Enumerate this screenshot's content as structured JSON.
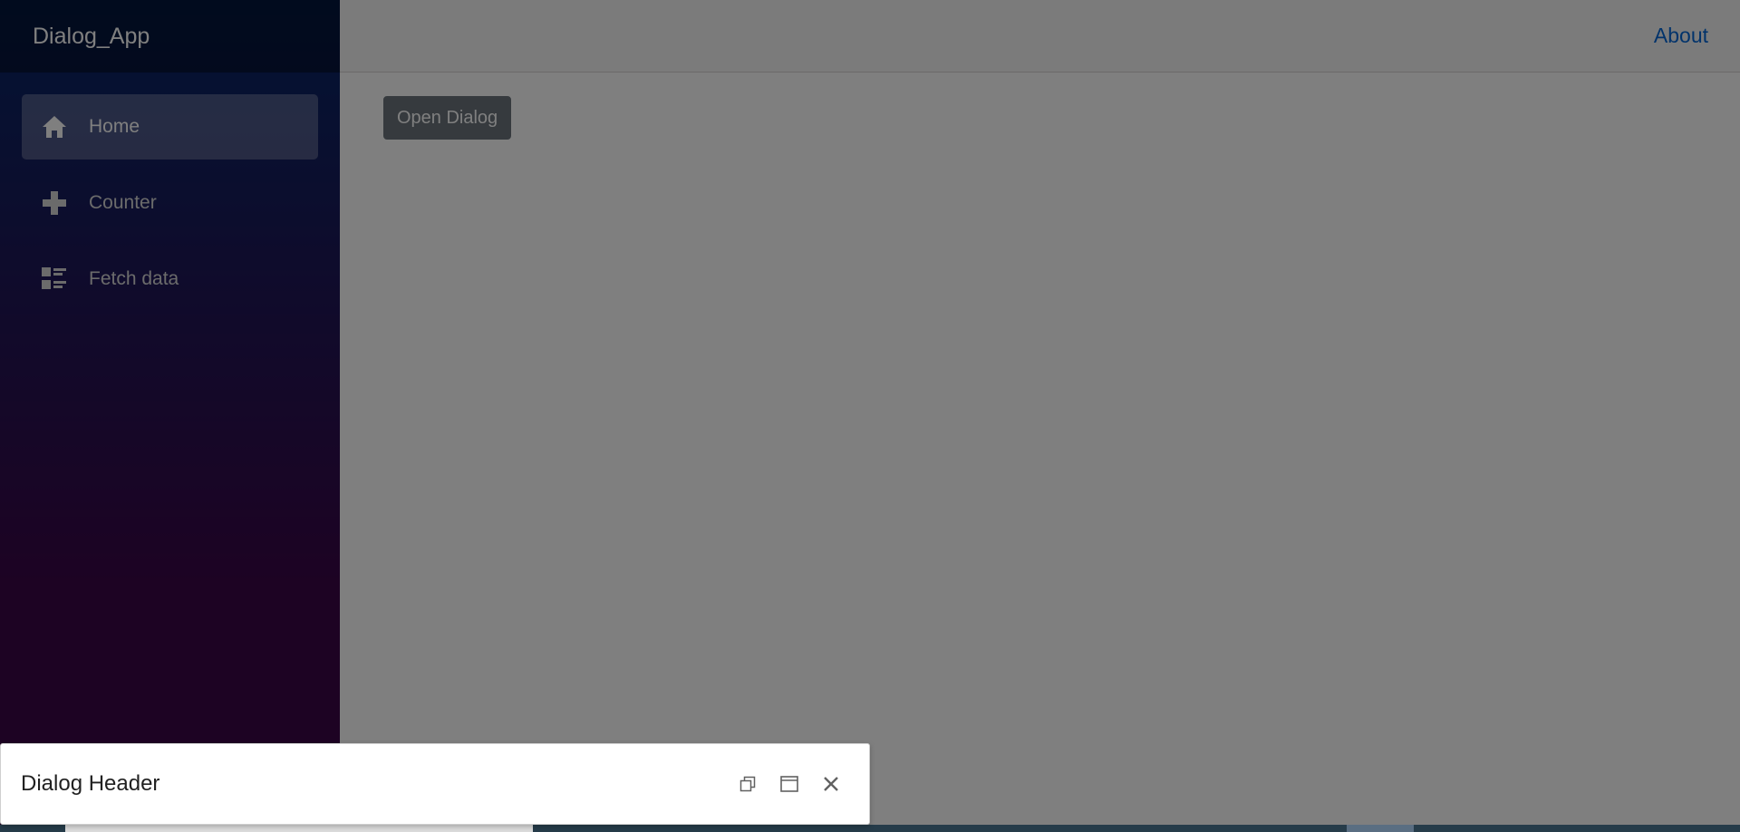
{
  "app": {
    "brand": "Dialog_App"
  },
  "sidebar": {
    "items": [
      {
        "label": "Home",
        "icon": "home-icon",
        "active": true
      },
      {
        "label": "Counter",
        "icon": "plus-icon",
        "active": false
      },
      {
        "label": "Fetch data",
        "icon": "list-rich-icon",
        "active": false
      }
    ]
  },
  "top_row": {
    "about_label": "About"
  },
  "main": {
    "open_dialog_label": "Open Dialog"
  },
  "dialog": {
    "header": "Dialog Header",
    "buttons": [
      "restore-icon",
      "maximize-icon",
      "close-icon"
    ]
  },
  "colors": {
    "sidebar_gradient_start": "#052767",
    "sidebar_gradient_end": "#3a0647",
    "link": "#0366d6",
    "button_secondary": "#6c757d"
  }
}
